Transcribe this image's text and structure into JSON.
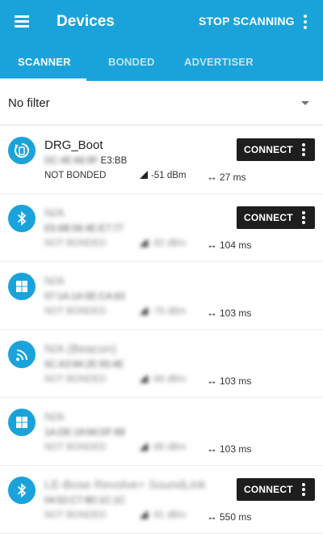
{
  "appbar": {
    "title": "Devices",
    "stop_label": "STOP SCANNING"
  },
  "tabs": [
    "SCANNER",
    "BONDED",
    "ADVERTISER"
  ],
  "filter": {
    "label": "No filter"
  },
  "connect_label": "CONNECT",
  "devices": [
    {
      "name": "DRG_Boot",
      "address_hidden": "DC:4E:66:9F:",
      "address_visible": "E3:BB",
      "bond": "NOT BONDED",
      "rssi": "-51 dBm",
      "interval": "27 ms",
      "icon": "dfu-icon"
    },
    {
      "name": "N/A",
      "address": "E5:6B:58:4E:E7:77",
      "bond": "NOT BONDED",
      "rssi": "-82 dBm",
      "interval": "104 ms",
      "icon": "bluetooth-icon"
    },
    {
      "name": "N/A",
      "address": "07:1A:1A:5E:CA:63",
      "bond": "NOT BONDED",
      "rssi": "-76 dBm",
      "interval": "103 ms",
      "icon": "windows-icon"
    },
    {
      "name": "N/A (Beacon)",
      "address": "5C:A3:94:2E:93:4E",
      "bond": "NOT BONDED",
      "rssi": "-86 dBm",
      "interval": "103 ms",
      "icon": "beacon-icon"
    },
    {
      "name": "N/A",
      "address": "1A:DE:19:66:DF:88",
      "bond": "NOT BONDED",
      "rssi": "-86 dBm",
      "interval": "103 ms",
      "icon": "windows-icon"
    },
    {
      "name": "LE-Bose Revolve+ SoundLink",
      "address": "04:52:C7:9D:1C:1C",
      "bond": "NOT BONDED",
      "rssi": "-91 dBm",
      "interval": "550 ms",
      "icon": "bluetooth-icon"
    }
  ],
  "colors": {
    "primary": "#1aa3da",
    "button": "#1e1e1e"
  }
}
